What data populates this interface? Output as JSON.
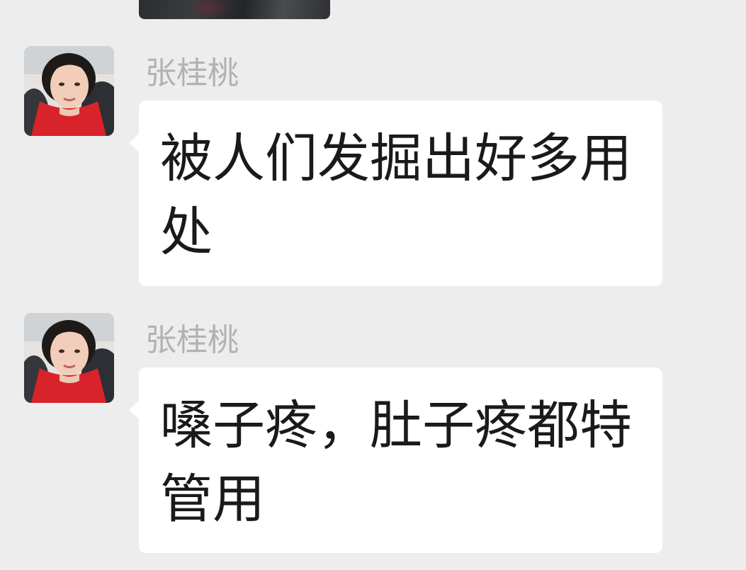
{
  "chat": {
    "messages": [
      {
        "sender": "张桂桃",
        "text": "被人们发掘出好多用处",
        "avatar_icon": "user-avatar-photo"
      },
      {
        "sender": "张桂桃",
        "text": "嗓子疼，肚子疼都特管用",
        "avatar_icon": "user-avatar-photo"
      }
    ]
  },
  "colors": {
    "background": "#ededed",
    "bubble": "#ffffff",
    "sender_name": "#b2b2b2",
    "message_text": "#1a1a1a"
  }
}
